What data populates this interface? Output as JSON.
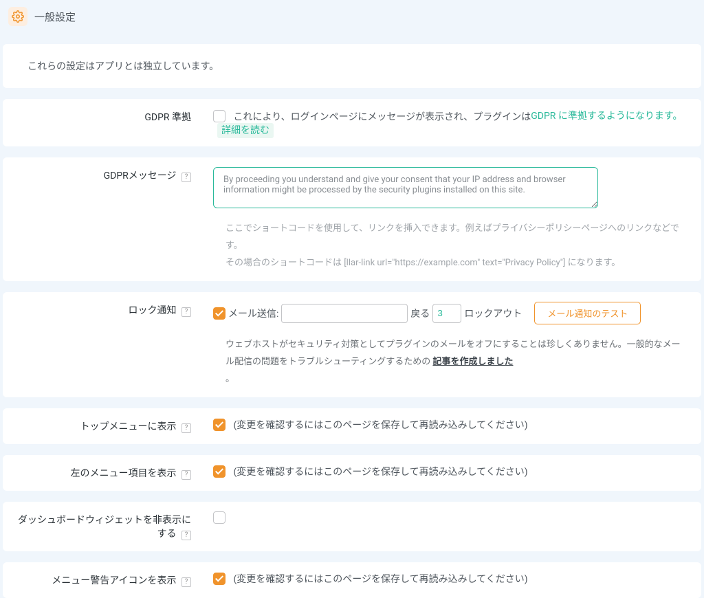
{
  "header": {
    "title": "一般設定"
  },
  "intro": {
    "text": "これらの設定はアプリとは独立しています。"
  },
  "gdpr": {
    "label": "GDPR 準拠",
    "checked": false,
    "desc_before": "これにより、ログインページにメッセージが表示され、プラグインは",
    "link_text": "GDPR に準拠するようになります。",
    "more": "詳細を読む"
  },
  "gdpr_msg": {
    "label": "GDPRメッセージ",
    "value": "By proceeding you understand and give your consent that your IP address and browser information might be processed by the security plugins installed on this site.",
    "help1": "ここでショートコードを使用して、リンクを挿入できます。例えばプライバシーポリシーページへのリンクなどです。",
    "help2": "その場合のショートコードは [llar-link url=\"https://example.com\" text=\"Privacy Policy\"] になります。"
  },
  "lock_notify": {
    "label": "ロック通知",
    "send_checked": true,
    "send_label": "メール送信:",
    "email_value": "",
    "after_every": "戻る",
    "count": "3",
    "lockout": "ロックアウト",
    "test_btn": "メール通知のテスト",
    "help_a": "ウェブホストがセキュリティ対策としてプラグインのメールをオフにすることは珍しくありません。一般的なメール配信の問題をトラブルシューティングするための ",
    "help_link": "記事を作成しました",
    "help_b": "。"
  },
  "save_hint": "(変更を確認するにはこのページを保存して再読み込みしてください)",
  "top_menu": {
    "label": "トップメニューに表示",
    "checked": true
  },
  "left_menu": {
    "label": "左のメニュー項目を表示",
    "checked": true
  },
  "hide_widget": {
    "label": "ダッシュボードウィジェットを非表示にする",
    "checked": false
  },
  "warn_icon": {
    "label": "メニュー警告アイコンを表示",
    "checked": true
  }
}
